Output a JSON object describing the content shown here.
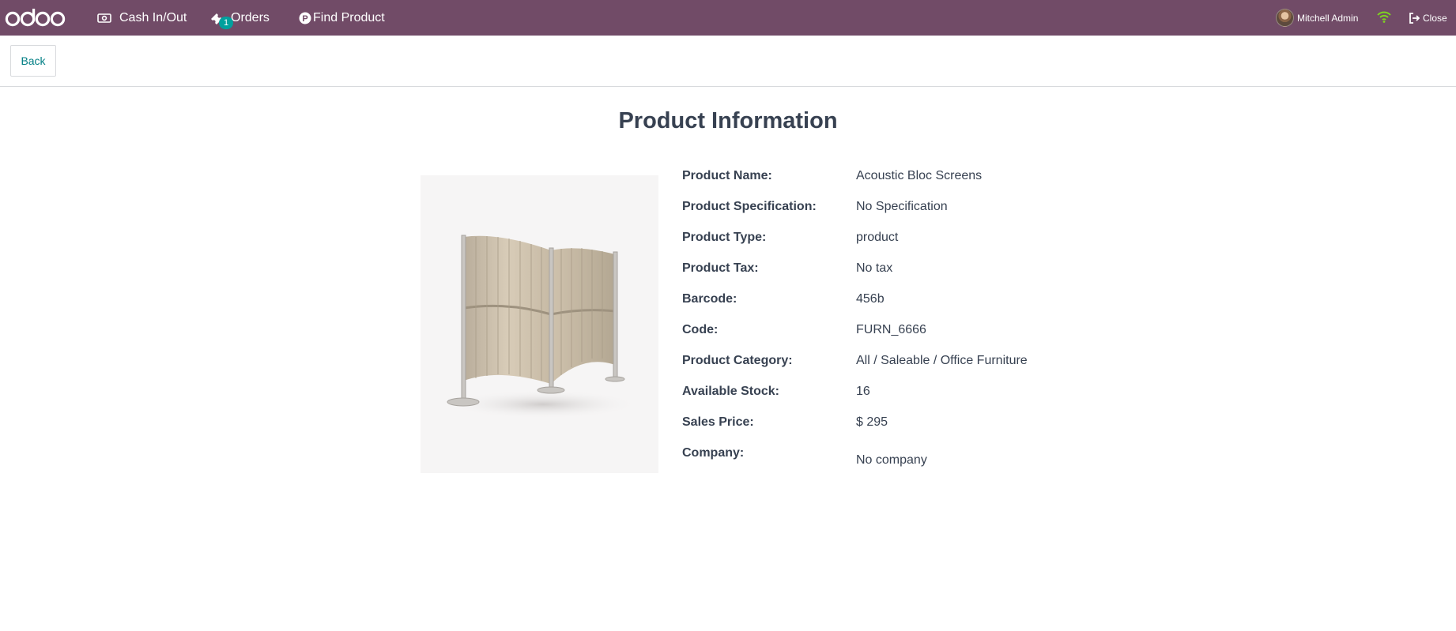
{
  "navbar": {
    "logo_text": "odoo",
    "cash_label": "Cash In/Out",
    "orders_label": "Orders",
    "orders_badge": "1",
    "find_label": "Find Product",
    "user_name": "Mitchell Admin",
    "close_label": "Close",
    "bg_color": "#714b67",
    "accent_color": "#00a09d"
  },
  "control": {
    "back_label": "Back"
  },
  "main": {
    "title": "Product Information",
    "image_alt": "Acoustic Bloc Screens",
    "fields": [
      {
        "label": "Product Name:",
        "value": "Acoustic Bloc Screens"
      },
      {
        "label": "Product Specification:",
        "value": "No Specification"
      },
      {
        "label": "Product Type:",
        "value": "product"
      },
      {
        "label": "Product Tax:",
        "value": "No tax"
      },
      {
        "label": "Barcode:",
        "value": "456b"
      },
      {
        "label": "Code:",
        "value": "FURN_6666"
      },
      {
        "label": "Product Category:",
        "value": "All / Saleable / Office Furniture"
      },
      {
        "label": "Available Stock:",
        "value": "16"
      },
      {
        "label": "Sales Price:",
        "value": "$ 295"
      },
      {
        "label": "Company:",
        "value": "No company"
      }
    ]
  }
}
